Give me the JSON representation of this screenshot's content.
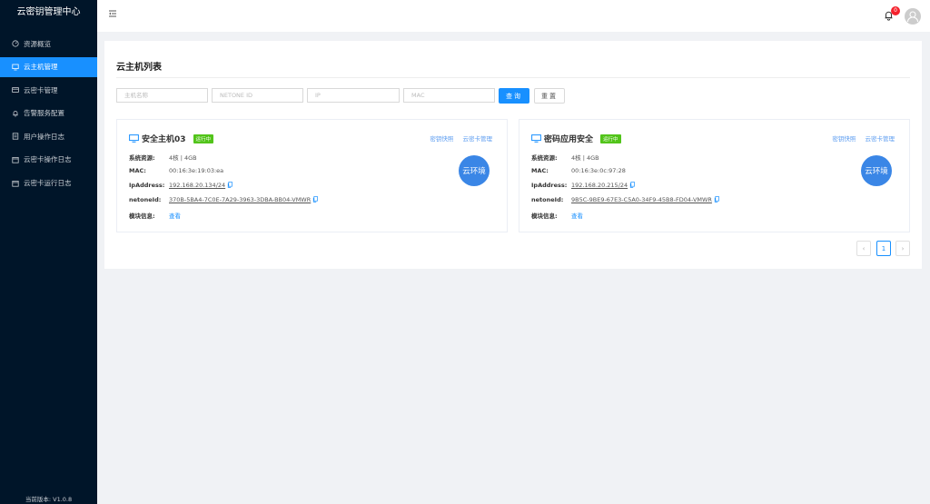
{
  "sidebar": {
    "title": "云密钥管理中心",
    "items": [
      {
        "label": "资源概览",
        "icon": "gauge-icon",
        "active": false
      },
      {
        "label": "云主机管理",
        "icon": "monitor-icon",
        "active": true
      },
      {
        "label": "云密卡管理",
        "icon": "card-icon",
        "active": false
      },
      {
        "label": "告警服务配置",
        "icon": "bell-icon",
        "active": false
      },
      {
        "label": "用户操作日志",
        "icon": "log-icon",
        "active": false
      },
      {
        "label": "云密卡操作日志",
        "icon": "calendar-icon",
        "active": false
      },
      {
        "label": "云密卡运行日志",
        "icon": "calendar-icon",
        "active": false
      }
    ],
    "version": "当前版本: V1.0.8"
  },
  "header": {
    "notification_count": "0"
  },
  "main": {
    "title": "云主机列表",
    "filters": {
      "host_name_placeholder": "主机名称",
      "netone_id_placeholder": "NETONE ID",
      "ip_placeholder": "IP",
      "mac_placeholder": "MAC"
    },
    "search_label": "查询",
    "reset_label": "重置",
    "hosts": [
      {
        "name": "安全主机03",
        "status": "运行中",
        "link_snapshot": "密钥快照",
        "link_card": "云密卡管理",
        "labels": {
          "resources": "系统资源:",
          "mac": "MAC:",
          "ip": "IpAddress:",
          "netone": "netoneId:",
          "module": "模块信息:"
        },
        "resources": "4核 | 4GB",
        "mac": "00:16:3e:19:03:ea",
        "ip": "192.168.20.134/24",
        "netone_id": "370B-5BA4-7C0E-7A29-3963-3DBA-BB04-VMWR",
        "module_link": "查看",
        "env": "云环境"
      },
      {
        "name": "密码应用安全",
        "status": "运行中",
        "link_snapshot": "密钥快照",
        "link_card": "云密卡管理",
        "labels": {
          "resources": "系统资源:",
          "mac": "MAC:",
          "ip": "IpAddress:",
          "netone": "netoneId:",
          "module": "模块信息:"
        },
        "resources": "4核 | 4GB",
        "mac": "00:16:3e:0c:97:28",
        "ip": "192.168.20.215/24",
        "netone_id": "9B5C-9BE9-67E3-C5A0-34F9-45B8-FD04-VMWR",
        "module_link": "查看",
        "env": "云环境"
      }
    ],
    "pagination": {
      "prev": "‹",
      "current": "1",
      "next": "›"
    }
  },
  "colors": {
    "sidebar_bg": "#001529",
    "accent": "#1890ff",
    "status_green": "#52c41a",
    "env_circle": "#3a86e6"
  }
}
